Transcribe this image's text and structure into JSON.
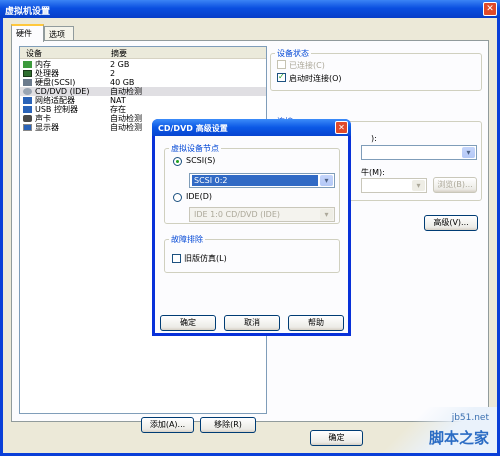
{
  "window": {
    "title": "虚拟机设置"
  },
  "tabs": [
    {
      "label": "硬件"
    },
    {
      "label": "选项"
    }
  ],
  "device_list": {
    "columns": [
      "设备",
      "摘要"
    ],
    "rows": [
      {
        "name": "内存",
        "summary": "2 GB",
        "icon": "memory-icon",
        "color": "#3c9a3c"
      },
      {
        "name": "处理器",
        "summary": "2",
        "icon": "processor-icon",
        "color": "#2f6f2f"
      },
      {
        "name": "硬盘(SCSI)",
        "summary": "40 GB",
        "icon": "hard-disk-icon",
        "color": "#6b7b8c"
      },
      {
        "name": "CD/DVD (IDE)",
        "summary": "自动检测",
        "icon": "cd-dvd-icon",
        "color": "#9aa5b2"
      },
      {
        "name": "网络适配器",
        "summary": "NAT",
        "icon": "network-adapter-icon",
        "color": "#2a63b8"
      },
      {
        "name": "USB 控制器",
        "summary": "存在",
        "icon": "usb-icon",
        "color": "#2a63b8"
      },
      {
        "name": "声卡",
        "summary": "自动检测",
        "icon": "speaker-icon",
        "color": "#4a4a4a"
      },
      {
        "name": "显示器",
        "summary": "自动检测",
        "icon": "monitor-icon",
        "color": "#2a63b8"
      }
    ],
    "add_button": "添加(A)...",
    "remove_button": "移除(R)"
  },
  "device_status": {
    "label": "设备状态",
    "connected": "已连接(C)",
    "connect_at_power_on": "启动时连接(O)",
    "connect_at_power_on_checked": true
  },
  "connection": {
    "label": "连接",
    "partial_label_1": "):",
    "partial_label_2": "牛(M):",
    "browse_button": "浏览(B)...",
    "advanced_button": "高级(V)..."
  },
  "footer": {
    "ok_button": "确定"
  },
  "dialog": {
    "title": "CD/DVD 高级设置",
    "node_group_label": "虚拟设备节点",
    "scsi_label": "SCSI(S)",
    "scsi_value": "SCSI 0:2",
    "ide_label": "IDE(D)",
    "ide_value": "IDE 1:0   CD/DVD (IDE)",
    "legacy_group_label": "故障排除",
    "legacy_label": "旧版仿真(L)",
    "ok_button": "确定",
    "cancel_button": "取消",
    "help_button": "帮助"
  },
  "watermark": {
    "site": "jb51.net",
    "text": "脚本之家"
  }
}
